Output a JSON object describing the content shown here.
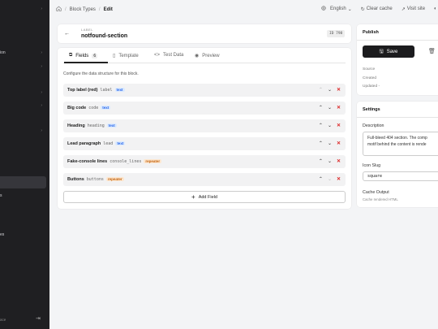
{
  "sidebar": {
    "items": [
      "ion",
      "s",
      "es"
    ],
    "bottom_text": "ace"
  },
  "breadcrumb": {
    "items": [
      "Block Types",
      "Edit"
    ]
  },
  "topbar": {
    "language": "English",
    "clear_cache": "Clear cache",
    "visit_site": "Visit site"
  },
  "header": {
    "label": "LABEL",
    "title": "notfound-section",
    "id_badge": "ID 798"
  },
  "tabs": [
    {
      "label": "Fields",
      "count": "6"
    },
    {
      "label": "Template"
    },
    {
      "label": "Test Data"
    },
    {
      "label": "Preview"
    }
  ],
  "fields_description": "Configure the data structure for this block.",
  "fields": [
    {
      "name": "Top label (red)",
      "key": "label",
      "type": "text"
    },
    {
      "name": "Big code",
      "key": "code",
      "type": "text"
    },
    {
      "name": "Heading",
      "key": "heading",
      "type": "text"
    },
    {
      "name": "Lead paragraph",
      "key": "lead",
      "type": "text"
    },
    {
      "name": "Fake-console lines",
      "key": "console_lines",
      "type": "repeater"
    },
    {
      "name": "Buttons",
      "key": "buttons",
      "type": "repeater"
    }
  ],
  "add_field_label": "Add Field",
  "publish": {
    "title": "Publish",
    "save_label": "Save",
    "source_label": "Source",
    "created_label": "Created",
    "updated_label": "Updated",
    "updated_value": "-"
  },
  "settings": {
    "title": "Settings",
    "description_label": "Description",
    "description_line1": "Full-bleed 404 section. The comp",
    "description_line2": "motif behind the content is rende",
    "icon_slug_label": "Icon Slug",
    "icon_slug_value": "square",
    "cache_output_label": "Cache Output",
    "cache_output_sub": "Cache rendered HTML"
  },
  "colors": {
    "accent_dark": "#1c1c1e",
    "delete_red": "#dc2626",
    "text_badge": "#2563eb",
    "repeater_badge": "#c2620f"
  }
}
